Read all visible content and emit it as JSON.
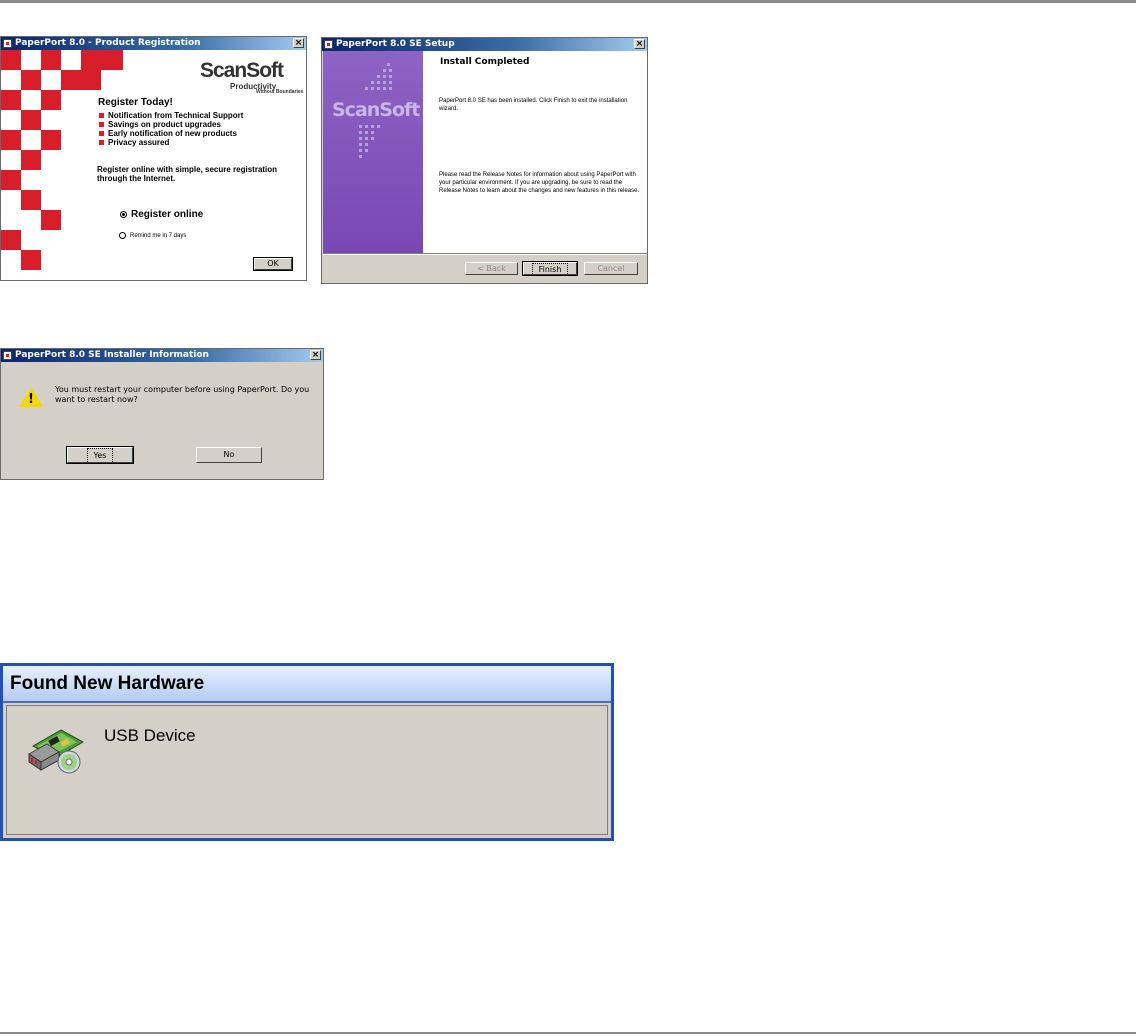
{
  "registration": {
    "title": "PaperPort 8.0 - Product Registration",
    "logo": "ScanSoft",
    "tagline_main": "Productivity",
    "tagline_sub": "Without Boundaries",
    "heading": "Register Today!",
    "bullets": [
      "Notification from Technical Support",
      "Savings on product upgrades",
      "Early notification of new products",
      "Privacy assured"
    ],
    "paragraph": "Register online with simple, secure registration through the Internet.",
    "option_online": "Register online",
    "option_remind": "Remind me in 7 days",
    "ok_label": "OK",
    "colors": {
      "accent": "#d81e2a"
    }
  },
  "setup": {
    "title": "PaperPort 8.0 SE Setup",
    "logo": "ScanSoft",
    "heading": "Install Completed",
    "message1": "PaperPort 8.0 SE has been installed. Click Finish to exit the installation wizard.",
    "message2": "Please read the Release Notes for information about using PaperPort with your particular environment. If you are upgrading, be sure to read the Release Notes to learn about the changes and new features in this release.",
    "back_label": "< Back",
    "finish_label": "Finish",
    "cancel_label": "Cancel",
    "colors": {
      "sidebar": "#7a48b4"
    }
  },
  "installer_info": {
    "title": "PaperPort 8.0 SE Installer Information",
    "message": "You must restart your computer before using PaperPort. Do you want to restart now?",
    "yes_label": "Yes",
    "no_label": "No",
    "icon": "warning-icon"
  },
  "hardware": {
    "title": "Found New Hardware",
    "device": "USB Device",
    "icon": "hardware-install-icon"
  }
}
